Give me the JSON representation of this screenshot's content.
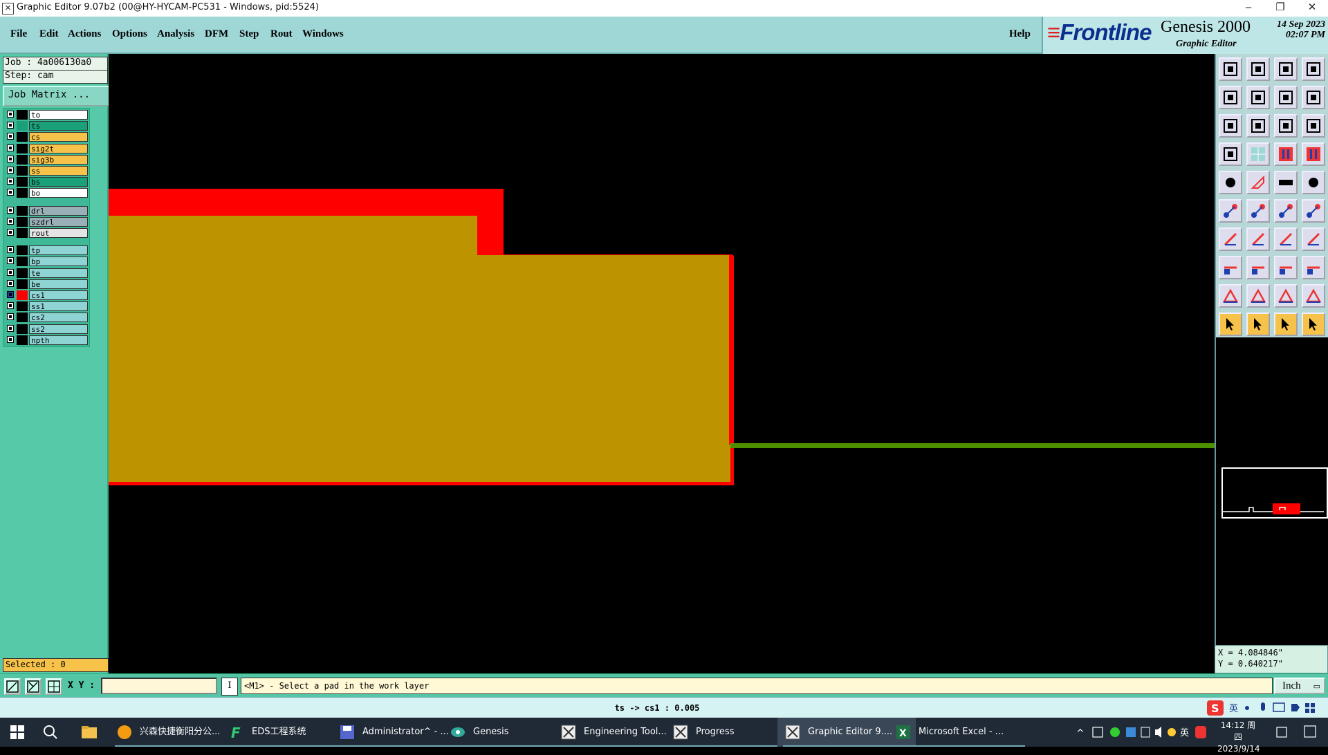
{
  "window": {
    "title": "Graphic Editor 9.07b2 (00@HY-HYCAM-PC531 - Windows, pid:5524)",
    "min": "–",
    "max": "❐",
    "close": "✕"
  },
  "menubar": {
    "items": [
      "File",
      "Edit",
      "Actions",
      "Options",
      "Analysis",
      "DFM",
      "Step",
      "Rout",
      "Windows"
    ],
    "help": "Help"
  },
  "brand": {
    "logo_prefix": "≡",
    "logo": "Frontline",
    "product": "Genesis 2000",
    "subtitle": "Graphic Editor",
    "date_line1": "14 Sep 2023",
    "date_line2": "02:07 PM"
  },
  "left": {
    "job": "Job : 4a006130a0",
    "step": "Step: cam",
    "job_matrix": "Job Matrix ...",
    "selected": "Selected : 0",
    "layers": [
      {
        "name": "to",
        "bg": "#ffffff",
        "color": "#000000"
      },
      {
        "name": "ts",
        "bg": "#1aa07a",
        "color": "#1aa07a"
      },
      {
        "name": "cs",
        "bg": "#f6c24a",
        "color": "#000000"
      },
      {
        "name": "sig2t",
        "bg": "#f6c24a",
        "color": "#000000"
      },
      {
        "name": "sig3b",
        "bg": "#f6c24a",
        "color": "#000000"
      },
      {
        "name": "ss",
        "bg": "#f6c24a",
        "color": "#000000"
      },
      {
        "name": "bs",
        "bg": "#1aa07a",
        "color": "#000000"
      },
      {
        "name": "bo",
        "bg": "#ffffff",
        "color": "#000000"
      },
      {
        "name": "drl",
        "bg": "#9ab0b8",
        "color": "#000000"
      },
      {
        "name": "szdrl",
        "bg": "#9ab0b8",
        "color": "#000000"
      },
      {
        "name": "rout",
        "bg": "#e4e4e4",
        "color": "#000000"
      },
      {
        "name": "tp",
        "bg": "#8fd4d4",
        "color": "#000000"
      },
      {
        "name": "bp",
        "bg": "#8fd4d4",
        "color": "#000000"
      },
      {
        "name": "te",
        "bg": "#8fd4d4",
        "color": "#000000"
      },
      {
        "name": "be",
        "bg": "#8fd4d4",
        "color": "#000000"
      },
      {
        "name": "cs1",
        "bg": "#8fd4d4",
        "color": "#ff0000",
        "work": true
      },
      {
        "name": "ss1",
        "bg": "#8fd4d4",
        "color": "#000000"
      },
      {
        "name": "cs2",
        "bg": "#8fd4d4",
        "color": "#000000"
      },
      {
        "name": "ss2",
        "bg": "#8fd4d4",
        "color": "#000000"
      },
      {
        "name": "npth",
        "bg": "#8fd4d4",
        "color": "#000000"
      }
    ]
  },
  "colors": {
    "copper": "#bd9300",
    "outline": "#ff0000",
    "trace": "#4e8f00",
    "canvas": "#000000"
  },
  "coords": {
    "x": "X = 4.084846\"",
    "y": "Y = 0.640217\""
  },
  "cmdbar": {
    "xy_label": "X Y :",
    "xy_value": "",
    "info": "I",
    "prompt": "<M1> - Select a pad in the work layer",
    "unit": "Inch"
  },
  "status": {
    "text": "ts -> cs1 : 0.005"
  },
  "ime": {
    "lang": "英"
  },
  "taskbar": {
    "items": [
      {
        "label": "兴森快捷衡阳分公...",
        "icon": "folder-app-icon"
      },
      {
        "label": "EDS工程系统",
        "icon": "eds-icon"
      },
      {
        "label": "Administrator^ - ...",
        "icon": "floppy-icon"
      },
      {
        "label": "Genesis",
        "icon": "genesis-icon"
      },
      {
        "label": "Engineering Tool...",
        "icon": "genesis-window-icon"
      },
      {
        "label": "Progress",
        "icon": "genesis-window-icon"
      },
      {
        "label": "Graphic Editor 9....",
        "icon": "genesis-window-icon",
        "active": true
      },
      {
        "label": "Microsoft Excel - ...",
        "icon": "excel-icon"
      }
    ],
    "tray_lang": "英",
    "time": "14:12 周四",
    "date": "2023/9/14"
  }
}
